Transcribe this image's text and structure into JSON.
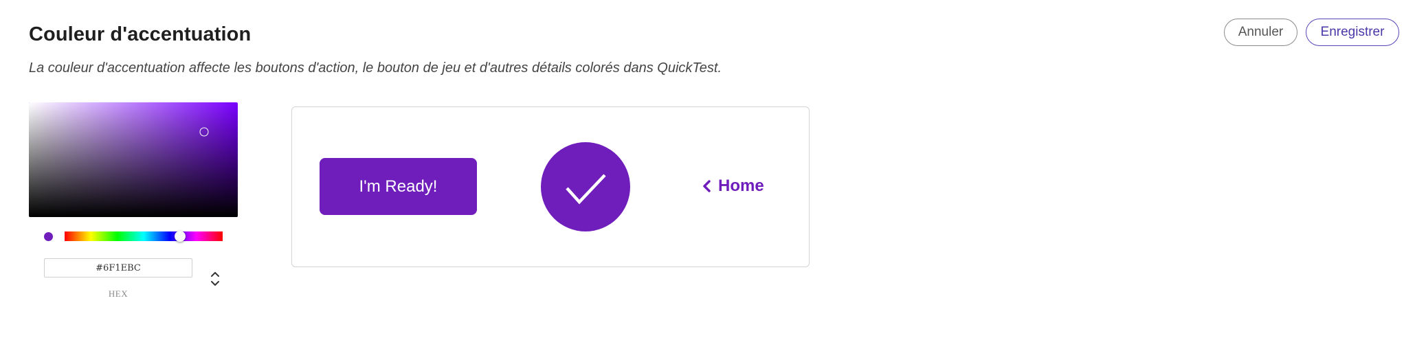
{
  "header": {
    "title": "Couleur d'accentuation",
    "subtitle": "La couleur d'accentuation affecte les boutons d'action, le bouton de jeu et d'autres détails colorés dans QuickTest."
  },
  "actions": {
    "cancel_label": "Annuler",
    "save_label": "Enregistrer"
  },
  "picker": {
    "hex_value": "#6F1EBC",
    "format_label": "HEX",
    "hue_fraction": 0.73,
    "saturation_fraction": 0.84,
    "value_fraction": 0.74,
    "hue_color": "#7a00ff"
  },
  "preview": {
    "ready_button_label": "I'm Ready!",
    "home_link_label": "Home",
    "icons": [
      "checkmark-icon",
      "chevron-left-icon"
    ]
  },
  "colors": {
    "accent": "#6F1EBC",
    "save_border": "#5b42b8",
    "cancel_border": "#8a8a8a"
  }
}
